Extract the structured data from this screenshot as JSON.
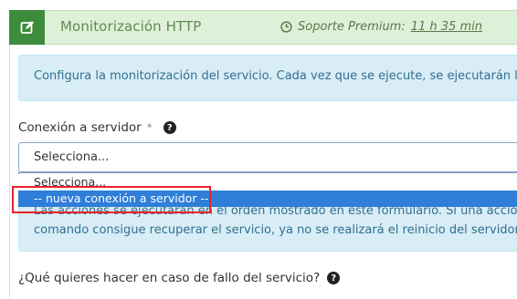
{
  "header": {
    "title": "Monitorización HTTP",
    "edit_icon": "edit-icon",
    "support_label": "Soporte Premium:",
    "support_time": "11 h 35 min",
    "clock_icon": "clock-icon"
  },
  "info": {
    "text": "Configura la monitorización del servicio. Cada vez que se ejecute, se ejecutarán las accio"
  },
  "field": {
    "label": "Conexión a servidor",
    "required_mark": "*",
    "help_icon": "question-circle-icon"
  },
  "select": {
    "value": "Selecciona...",
    "options": [
      "Selecciona...",
      "-- nueva conexión a servidor --"
    ],
    "highlighted_index": 1
  },
  "alert2": {
    "line1": "Las acciones se ejecutarán en el orden mostrado en este formulario. Si una acción consig",
    "line2": "comando consigue recuperar el servicio, ya no se realizará el reinicio del servidor."
  },
  "question": {
    "label": "¿Qué quieres hacer en caso de fallo del servicio?",
    "help_icon": "question-circle-icon"
  },
  "colors": {
    "header_bg": "#dff0d8",
    "icon_box": "#3d8b3d",
    "info_bg": "#d9edf7",
    "info_text": "#31708f",
    "option_highlight": "#2f7ed8",
    "annotation_red": "#e8212a"
  }
}
